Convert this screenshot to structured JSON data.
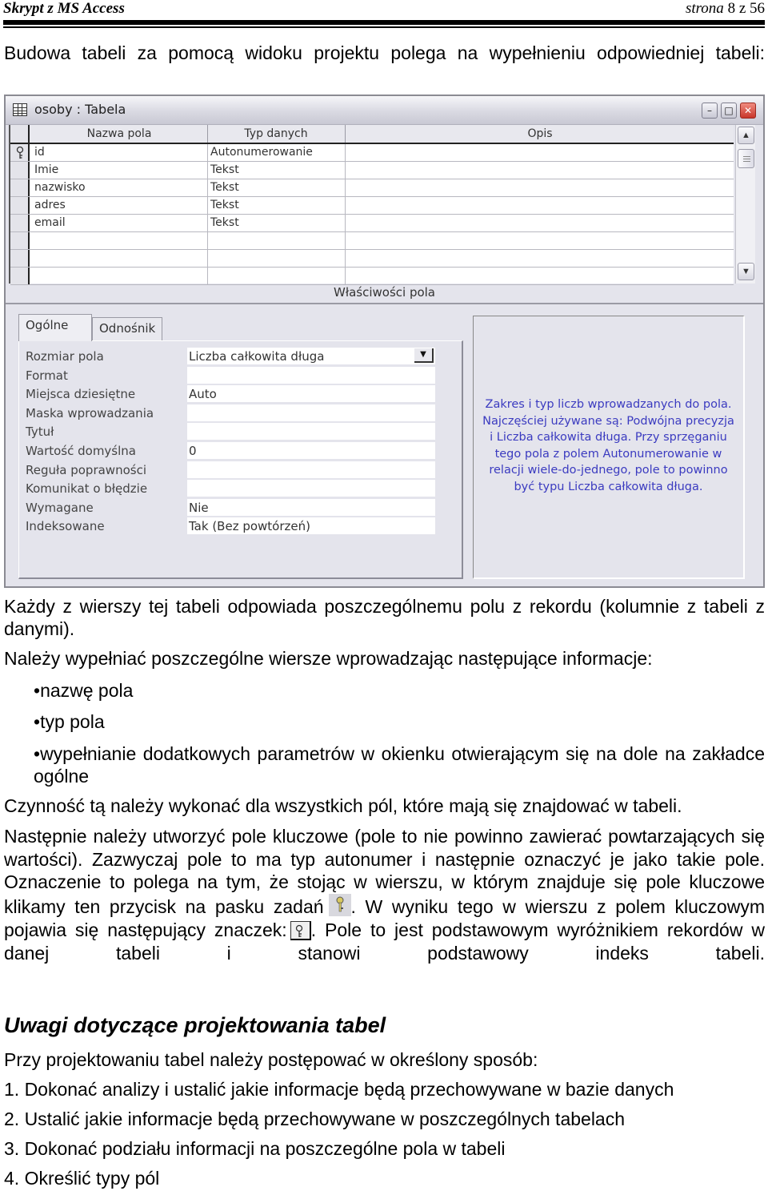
{
  "page_header": {
    "title": "Skrypt z MS  Access",
    "page_word": "strona",
    "page_current": "8",
    "page_of": "z",
    "page_total": "56"
  },
  "intro": "Budowa tabeli za pomocą widoku projektu polega na wypełnieniu odpowiedniej tabeli:",
  "window": {
    "title": "osoby : Tabela",
    "icons": [
      "table-icon",
      "minimize-icon",
      "maximize-icon",
      "close-icon"
    ],
    "grid": {
      "headers": [
        "Nazwa pola",
        "Typ danych",
        "Opis"
      ],
      "rows": [
        {
          "name": "id",
          "type": "Autonumerowanie",
          "description": "",
          "primary_key": true
        },
        {
          "name": "Imie",
          "type": "Tekst",
          "description": "",
          "primary_key": false
        },
        {
          "name": "nazwisko",
          "type": "Tekst",
          "description": "",
          "primary_key": false
        },
        {
          "name": "adres",
          "type": "Tekst",
          "description": "",
          "primary_key": false
        },
        {
          "name": "email",
          "type": "Tekst",
          "description": "",
          "primary_key": false
        },
        {
          "name": "",
          "type": "",
          "description": "",
          "primary_key": false
        },
        {
          "name": "",
          "type": "",
          "description": "",
          "primary_key": false
        },
        {
          "name": "",
          "type": "",
          "description": "",
          "primary_key": false
        }
      ]
    },
    "properties_label": "Właściwości pola",
    "tabs": [
      {
        "label": "Ogólne",
        "active": true
      },
      {
        "label": "Odnośnik",
        "active": false
      }
    ],
    "properties": [
      {
        "label": "Rozmiar pola",
        "value": "Liczba całkowita długa",
        "dropdown": true
      },
      {
        "label": "Format",
        "value": ""
      },
      {
        "label": "Miejsca dziesiętne",
        "value": "Auto"
      },
      {
        "label": "Maska wprowadzania",
        "value": ""
      },
      {
        "label": "Tytuł",
        "value": ""
      },
      {
        "label": "Wartość domyślna",
        "value": "0"
      },
      {
        "label": "Reguła poprawności",
        "value": ""
      },
      {
        "label": "Komunikat o błędzie",
        "value": ""
      },
      {
        "label": "Wymagane",
        "value": "Nie"
      },
      {
        "label": "Indeksowane",
        "value": "Tak (Bez powtórzeń)"
      }
    ],
    "help_lines": [
      "Zakres i typ liczb wprowadzanych do pola.",
      "Najczęściej używane są: Podwójna precyzja",
      "i Liczba całkowita długa. Przy sprzęganiu",
      "tego pola z polem Autonumerowanie w",
      "relacji wiele-do-jednego, pole to powinno",
      "być typu Liczba całkowita długa."
    ],
    "help_color": "#3b3bc0"
  },
  "body": {
    "p1": "Każdy z wierszy tej tabeli odpowiada poszczególnemu polu z rekordu (kolumnie z tabeli z danymi).",
    "p2": "Należy wypełniać poszczególne wiersze wprowadzając następujące informacje:",
    "bullets": [
      "nazwę pola",
      "typ pola",
      "wypełnianie dodatkowych parametrów w okienku otwierającym się na dole na zakładce ogólne"
    ],
    "bullet_char": "•",
    "p3": "Czynność tą należy wykonać dla wszystkich pól, które mają się znajdować w tabeli.",
    "p4_a": "Następnie należy utworzyć pole kluczowe (pole to nie powinno zawierać powtarzających się wartości). Zazwyczaj pole to ma typ autonumer i następnie oznaczyć je jako takie pole. Oznaczenie to polega na tym, że stojąc w wierszu, w którym znajduje się pole kluczowe klikamy ten przycisk na pasku zadań",
    "p4_b": ". W wyniku tego w wierszu z polem kluczowym pojawia się następujący znaczek:",
    "p4_c": ". Pole to jest podstawowym wyróżnikiem rekordów w danej tabeli i stanowi podstawowy indeks tabeli.",
    "heading": "Uwagi dotyczące projektowania tabel",
    "p5": "Przy projektowaniu tabel należy postępować w określony sposób:",
    "steps": [
      "1. Dokonać analizy i ustalić jakie informacje będą przechowywane w bazie danych",
      "2. Ustalić jakie informacje będą przechowywane w poszczególnych tabelach",
      "3. Dokonać podziału informacji na poszczególne pola w tabeli",
      "4. Określić typy pól"
    ]
  }
}
